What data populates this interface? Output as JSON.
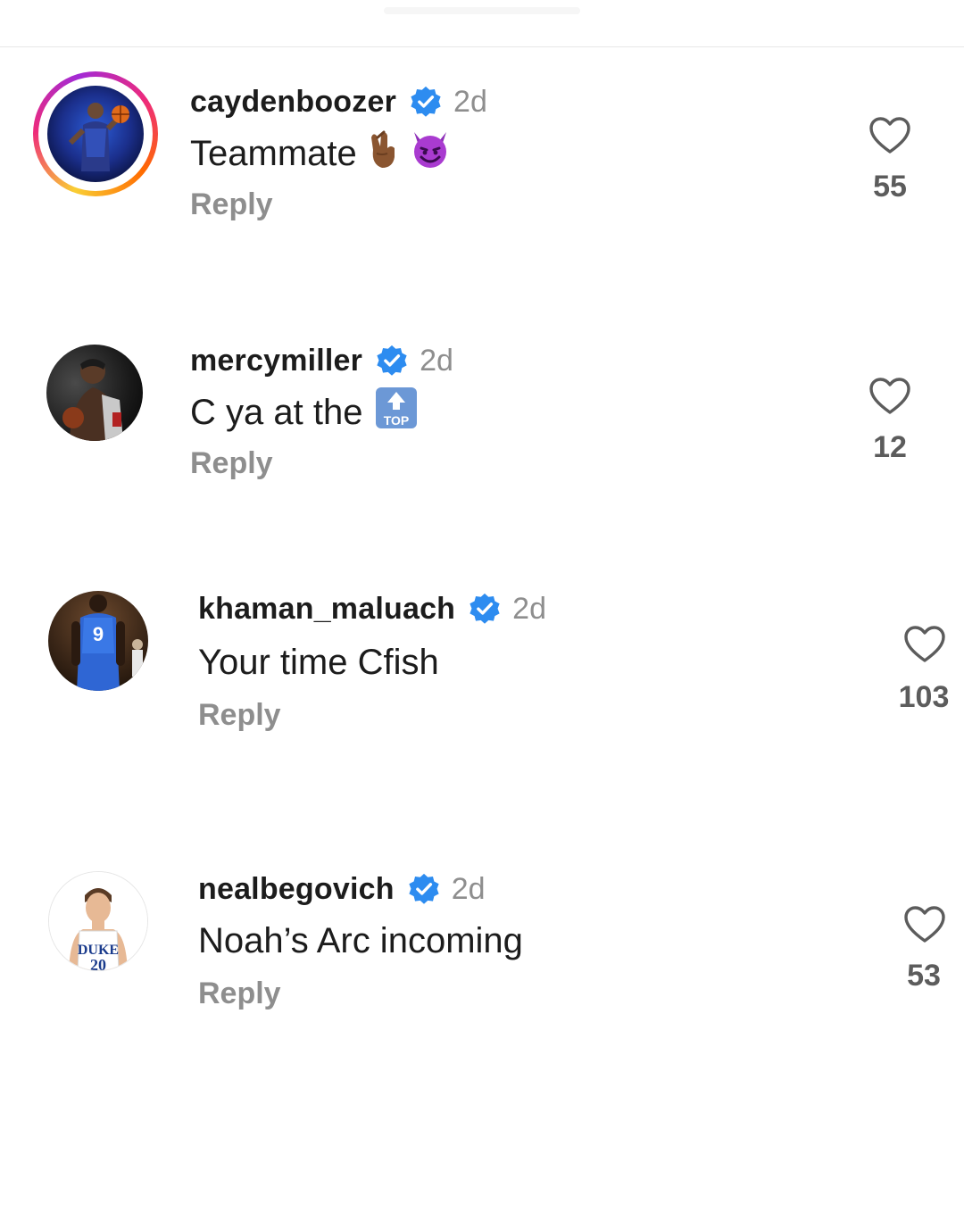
{
  "comments": [
    {
      "username": "caydenboozer",
      "time": "2d",
      "text": "Teammate",
      "emojis": [
        "crossed-fingers-emoji",
        "smiling-devil-emoji"
      ],
      "reply_label": "Reply",
      "likes": "55",
      "has_story_ring": true
    },
    {
      "username": "mercymiller",
      "time": "2d",
      "text": "C ya at the",
      "emojis": [
        "top-arrow-emoji"
      ],
      "reply_label": "Reply",
      "likes": "12",
      "has_story_ring": false
    },
    {
      "username": "khaman_maluach",
      "time": "2d",
      "text": "Your time Cfish",
      "emojis": [],
      "reply_label": "Reply",
      "likes": "103",
      "has_story_ring": false
    },
    {
      "username": "nealbegovich",
      "time": "2d",
      "text": "Noah’s Arc incoming",
      "emojis": [],
      "reply_label": "Reply",
      "likes": "53",
      "has_story_ring": false
    }
  ],
  "emoji_text": {
    "top": "TOP"
  },
  "colors": {
    "verified_blue": "#2d8cf0",
    "text_primary": "#1c1c1c",
    "text_secondary": "#8e8e8e",
    "like_count": "#5c5c5c"
  }
}
